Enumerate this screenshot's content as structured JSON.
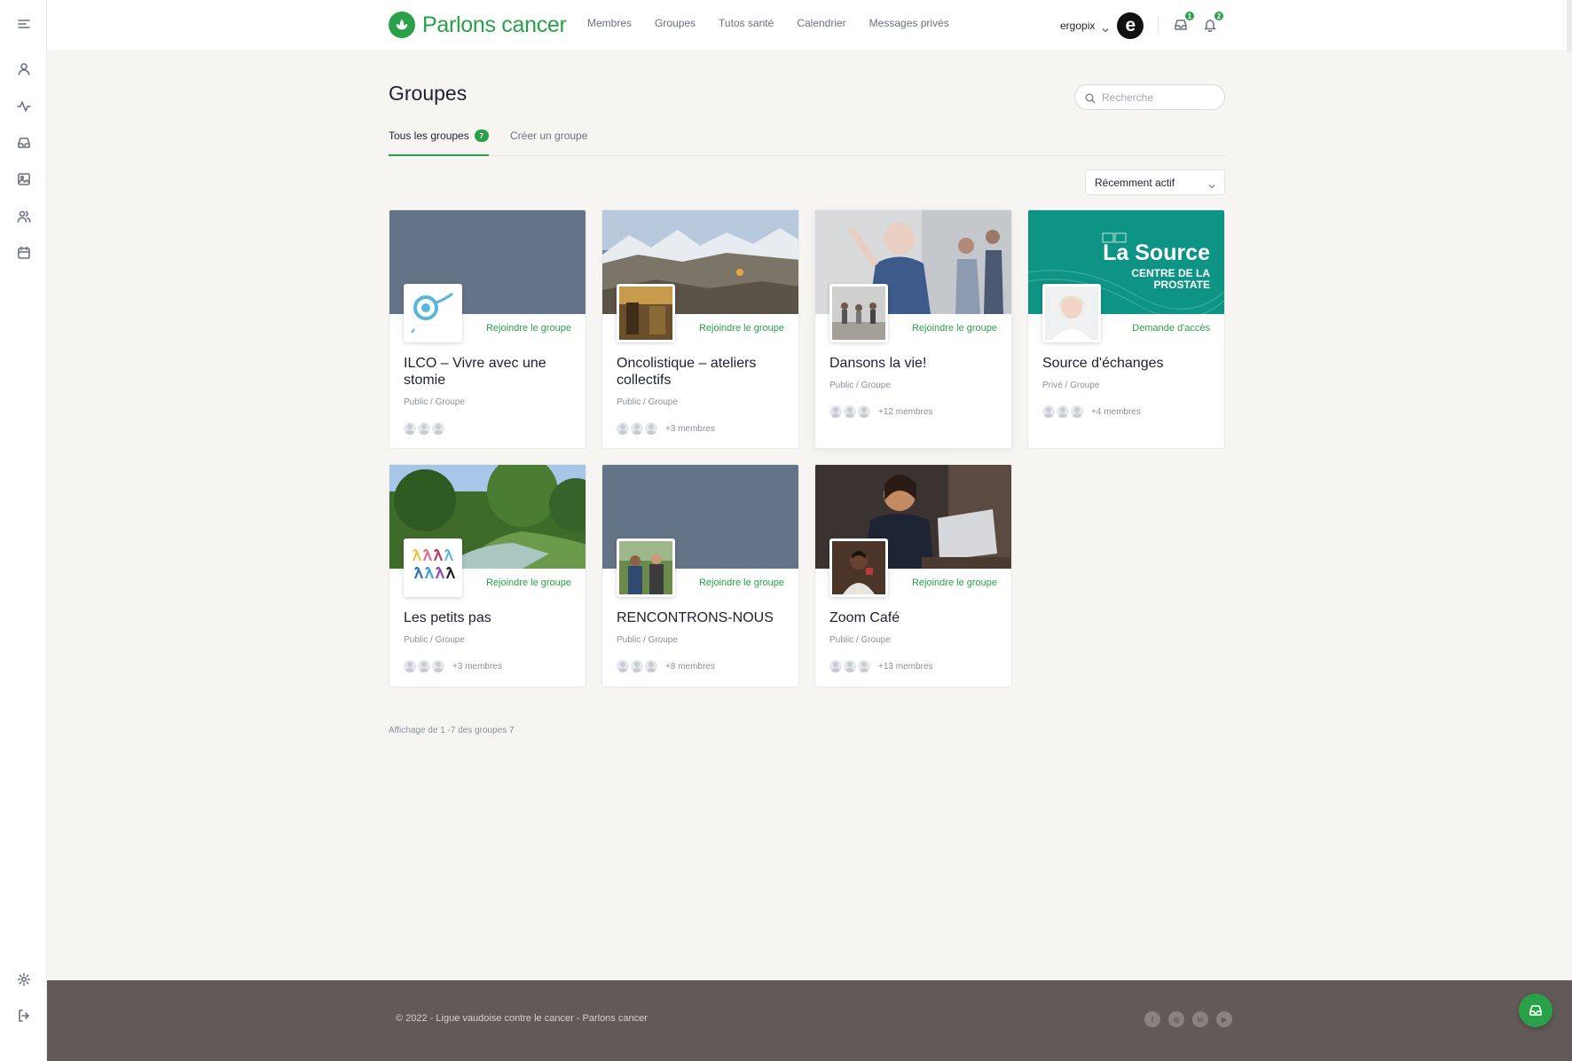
{
  "brand": {
    "name": "Parlons cancer",
    "accent_color": "#2aa148"
  },
  "sidebar": {
    "items": [
      {
        "icon": "menu-icon",
        "name": "menu"
      },
      {
        "icon": "user-icon",
        "name": "profile"
      },
      {
        "icon": "activity-icon",
        "name": "activity"
      },
      {
        "icon": "inbox-icon",
        "name": "inbox"
      },
      {
        "icon": "image-icon",
        "name": "photos"
      },
      {
        "icon": "users-icon",
        "name": "groups"
      },
      {
        "icon": "calendar-icon",
        "name": "calendar"
      },
      {
        "icon": "settings-icon",
        "name": "settings"
      },
      {
        "icon": "logout-icon",
        "name": "logout"
      }
    ]
  },
  "header": {
    "nav": [
      "Membres",
      "Groupes",
      "Tutos santé",
      "Calendrier",
      "Messages privés"
    ],
    "username": "ergopix",
    "avatar_letter": "e",
    "messages_count": "1",
    "notifications_count": "2"
  },
  "main": {
    "title": "Groupes",
    "search_placeholder": "Recherche",
    "tabs": [
      {
        "label": "Tous les groupes",
        "count": "7",
        "active": true
      },
      {
        "label": "Créer un groupe",
        "active": false
      }
    ],
    "sort_label": "Récemment actif",
    "pagination": "Affichage de 1 -7 des groupes 7"
  },
  "groups": [
    {
      "title": "ILCO – Vivre avec une stomie",
      "type": "Public / Groupe",
      "action": "Rejoindre le groupe",
      "members": ""
    },
    {
      "title": "Oncolistique – ateliers collectifs",
      "type": "Public / Groupe",
      "action": "Rejoindre le groupe",
      "members": "+3 membres"
    },
    {
      "title": "Dansons la vie!",
      "type": "Public / Groupe",
      "action": "Rejoindre le groupe",
      "members": "+12 membres"
    },
    {
      "title": "Source d'échanges",
      "type": "Privé / Groupe",
      "action": "Demande d'accès",
      "members": "+4 membres",
      "cover_text": {
        "line1": "La Source",
        "line2": "CENTRE DE LA",
        "line3": "PROSTATE"
      }
    },
    {
      "title": "Les petits pas",
      "type": "Public / Groupe",
      "action": "Rejoindre le groupe",
      "members": "+3 membres"
    },
    {
      "title": "RENCONTRONS-NOUS",
      "type": "Public / Groupe",
      "action": "Rejoindre le groupe",
      "members": "+8 membres"
    },
    {
      "title": "Zoom Café",
      "type": "Public / Groupe",
      "action": "Rejoindre le groupe",
      "members": "+13 membres"
    }
  ],
  "footer": {
    "copyright": "© 2022 - Ligue vaudoise contre le cancer - Parlons cancer",
    "socials": [
      {
        "icon": "facebook-icon",
        "glyph": "f"
      },
      {
        "icon": "instagram-icon",
        "glyph": "◎"
      },
      {
        "icon": "linkedin-icon",
        "glyph": "in"
      },
      {
        "icon": "youtube-icon",
        "glyph": "▶"
      }
    ]
  }
}
